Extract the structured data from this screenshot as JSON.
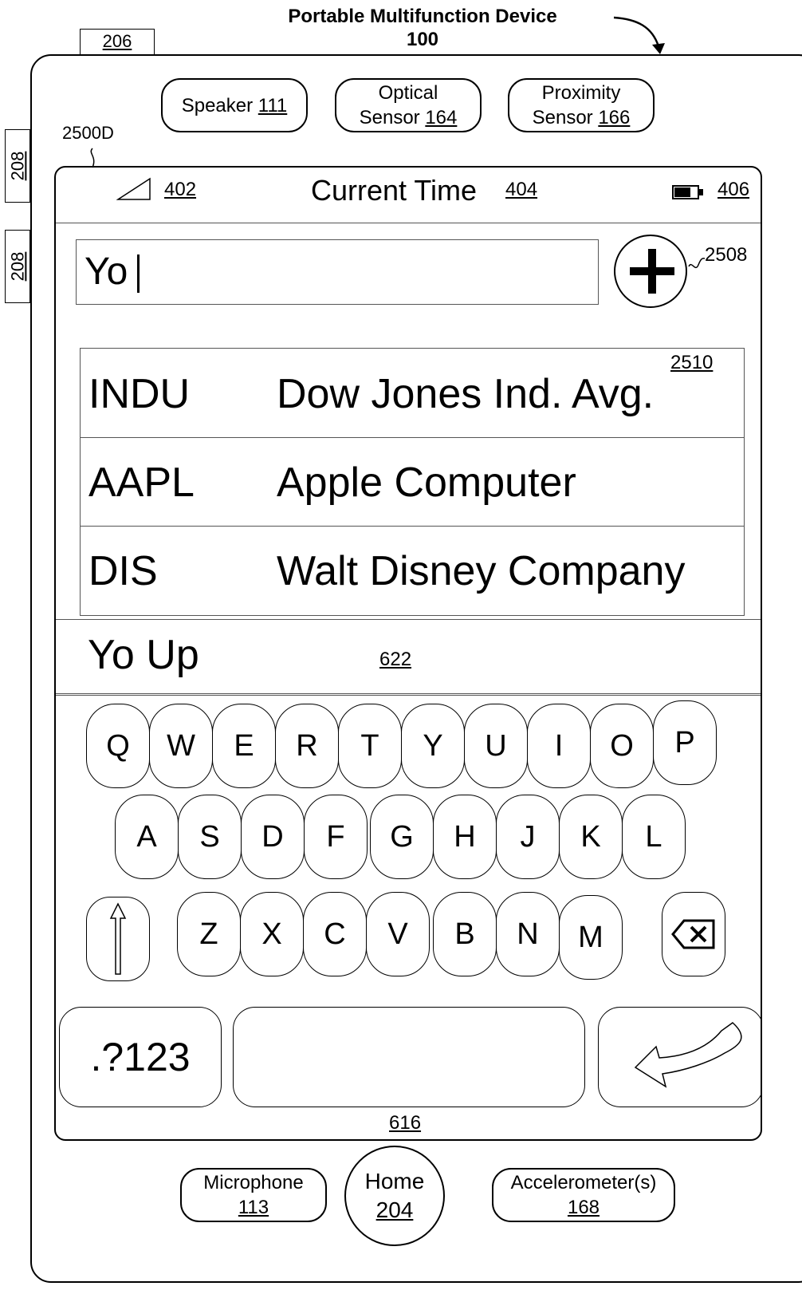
{
  "device": {
    "title": "Portable Multifunction Device",
    "ref": "100"
  },
  "hardware": {
    "top_tab": "206",
    "side_buttons": [
      "208",
      "208"
    ],
    "speaker": {
      "label": "Speaker",
      "ref": "111"
    },
    "optical_sensor": {
      "label1": "Optical",
      "label2": "Sensor",
      "ref": "164"
    },
    "proximity_sensor": {
      "label1": "Proximity",
      "label2": "Sensor",
      "ref": "166"
    },
    "microphone": {
      "label": "Microphone",
      "ref": "113"
    },
    "home": {
      "label": "Home",
      "ref": "204"
    },
    "accelerometer": {
      "label": "Accelerometer(s)",
      "ref": "168"
    }
  },
  "screen": {
    "ref": "2500D"
  },
  "status_bar": {
    "signal_ref": "402",
    "time_label": "Current Time",
    "time_ref": "404",
    "battery_ref": "406"
  },
  "search": {
    "value": "Yo",
    "add_ref": "2508"
  },
  "results": {
    "ref": "2510",
    "items": [
      {
        "symbol": "INDU",
        "name": "Dow Jones Ind. Avg."
      },
      {
        "symbol": "AAPL",
        "name": "Apple Computer"
      },
      {
        "symbol": "DIS",
        "name": "Walt Disney Company"
      }
    ]
  },
  "suggestion": {
    "text": "Yo Up",
    "ref": "622"
  },
  "keyboard": {
    "ref": "616",
    "row1": [
      "Q",
      "W",
      "E",
      "R",
      "T",
      "Y",
      "U",
      "I",
      "O",
      "P"
    ],
    "row2": [
      "A",
      "S",
      "D",
      "F",
      "G",
      "H",
      "J",
      "K",
      "L"
    ],
    "row3": [
      "Z",
      "X",
      "C",
      "V",
      "B",
      "N",
      "M"
    ],
    "numbers_label": ".?123",
    "icons": {
      "shift": "shift-arrow-icon",
      "backspace": "backspace-icon",
      "return": "return-arrow-icon"
    }
  }
}
